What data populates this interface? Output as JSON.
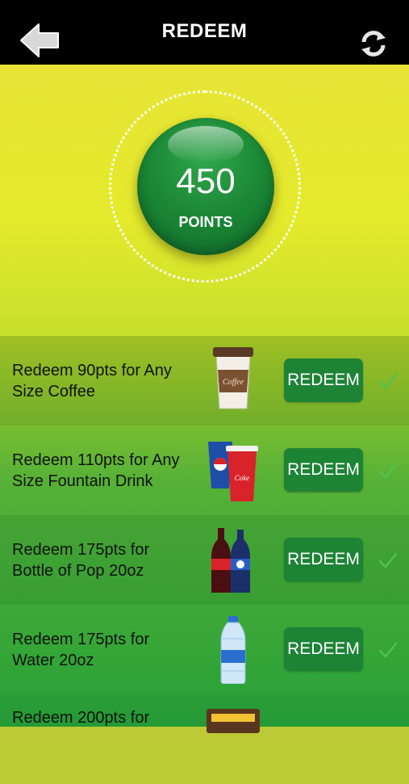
{
  "header": {
    "title": "REDEEM",
    "back_icon": "back-arrow-icon",
    "refresh_icon": "refresh-icon"
  },
  "balance": {
    "value": "450",
    "label": "POINTS"
  },
  "colors": {
    "brand_green": "#1d8436",
    "accent_yellow": "#e5ea2c",
    "topbar": "#000000"
  },
  "rewards": [
    {
      "text": "Redeem 90pts for Any Size Coffee",
      "button": "REDEEM",
      "image": "coffee-cup"
    },
    {
      "text": "Redeem 110pts for Any Size Fountain Drink",
      "button": "REDEEM",
      "image": "fountain-drinks"
    },
    {
      "text": "Redeem 175pts for Bottle of Pop 20oz",
      "button": "REDEEM",
      "image": "pop-bottles"
    },
    {
      "text": "Redeem 175pts for Water 20oz",
      "button": "REDEEM",
      "image": "water-bottle"
    },
    {
      "text": "Redeem 200pts for",
      "button": "",
      "image": "candy"
    }
  ]
}
